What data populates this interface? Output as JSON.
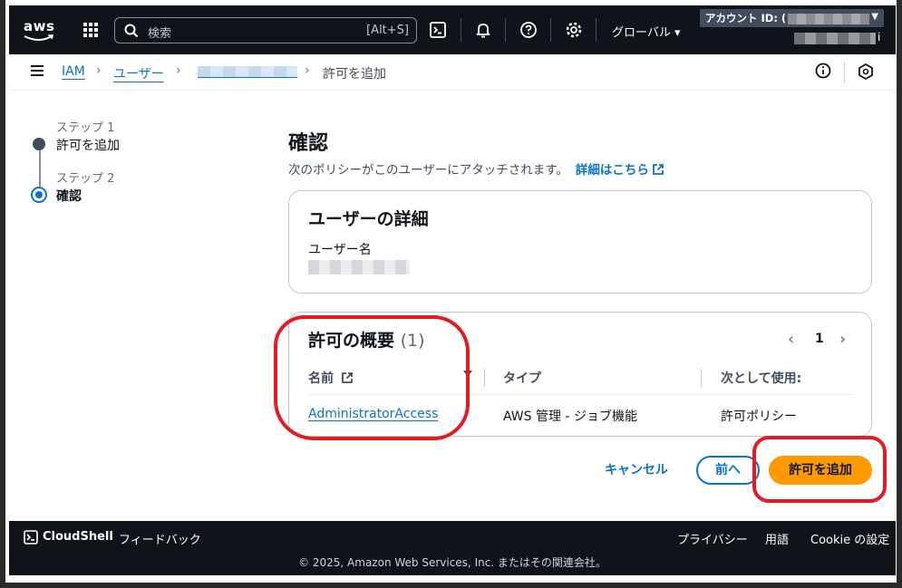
{
  "topnav": {
    "logo_text": "aws",
    "search_placeholder": "検索",
    "search_shortcut": "[Alt+S]",
    "region": "グローバル",
    "account_label": "アカウント ID: (",
    "user_suffix": "i"
  },
  "breadcrumb": {
    "items": [
      "IAM",
      "ユーザー"
    ],
    "current": "許可を追加"
  },
  "steps": [
    {
      "sub": "ステップ 1",
      "label": "許可を追加"
    },
    {
      "sub": "ステップ 2",
      "label": "確認"
    }
  ],
  "main": {
    "title": "確認",
    "description": "次のポリシーがこのユーザーにアタッチされます。",
    "learn_more": "詳細はこちら"
  },
  "user_details": {
    "title": "ユーザーの詳細",
    "username_label": "ユーザー名"
  },
  "permissions": {
    "title": "許可の概要",
    "count": "(1)",
    "page": "1",
    "columns": [
      "名前",
      "タイプ",
      "次として使用:"
    ],
    "rows": [
      {
        "name": "AdministratorAccess",
        "type": "AWS 管理 - ジョブ機能",
        "used_as": "許可ポリシー"
      }
    ]
  },
  "actions": {
    "cancel": "キャンセル",
    "previous": "前へ",
    "submit": "許可を追加"
  },
  "footer": {
    "cloudshell": "CloudShell",
    "feedback": "フィードバック",
    "privacy": "プライバシー",
    "terms": "用語",
    "cookie": "Cookie の設定",
    "copyright": "© 2025, Amazon Web Services, Inc. またはその関連会社。"
  },
  "colors": {
    "accent": "#0972d3",
    "primary_button": "#ff9900",
    "nav_bg": "#0f141a",
    "annotation": "#e31b23"
  }
}
